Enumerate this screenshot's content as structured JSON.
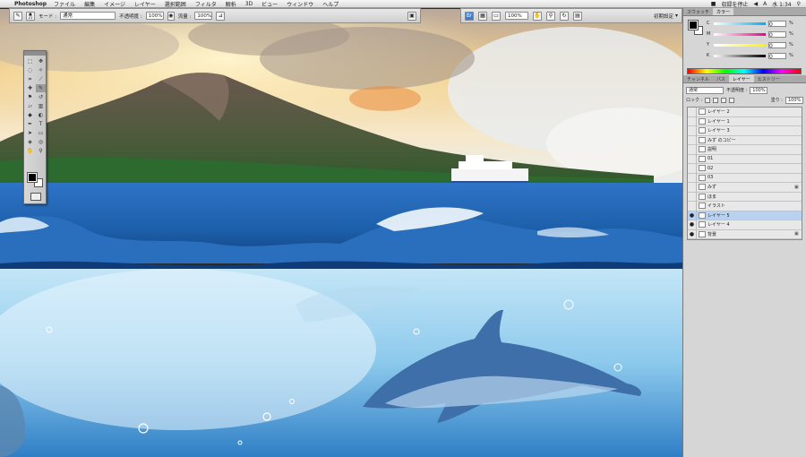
{
  "menubar": {
    "app_name": "Photoshop",
    "items": [
      "ファイル",
      "編集",
      "イメージ",
      "レイヤー",
      "選択範囲",
      "フィルタ",
      "解析",
      "3D",
      "ビュー",
      "ウィンドウ",
      "ヘルプ"
    ],
    "status_text": "収録を停止",
    "clock": "水 1:34"
  },
  "options_bar": {
    "brush_size": "21",
    "mode_label": "モード :",
    "mode_value": "通常",
    "opacity_label": "不透明度 :",
    "opacity_value": "100%",
    "flow_label": "流量 :",
    "flow_value": "100%"
  },
  "app_bar": {
    "zoom": "100%",
    "workspace": "初期設定"
  },
  "color_panel": {
    "tabs": [
      "スウォッチ",
      "カラー"
    ],
    "active_tab": "カラー",
    "channels": [
      {
        "label": "C",
        "value": "0",
        "unit": "%"
      },
      {
        "label": "M",
        "value": "0",
        "unit": "%"
      },
      {
        "label": "Y",
        "value": "0",
        "unit": "%"
      },
      {
        "label": "K",
        "value": "0",
        "unit": "%"
      }
    ]
  },
  "layers_panel": {
    "tabs": [
      "チャンネル",
      "パス",
      "レイヤー",
      "ヒストリー"
    ],
    "active_tab": "レイヤー",
    "blend_mode": "通常",
    "opacity_label": "不透明度 :",
    "opacity_value": "100%",
    "lock_label": "ロック :",
    "fill_label": "塗り :",
    "fill_value": "100%",
    "layers": [
      {
        "name": "レイヤー 2",
        "visible": false,
        "locked": false,
        "selected": false
      },
      {
        "name": "レイヤー 1",
        "visible": false,
        "locked": false,
        "selected": false
      },
      {
        "name": "レイヤー 3",
        "visible": false,
        "locked": false,
        "selected": false
      },
      {
        "name": "みず のコピー",
        "visible": false,
        "locked": false,
        "selected": false
      },
      {
        "name": "説明",
        "visible": false,
        "locked": false,
        "selected": false
      },
      {
        "name": "01",
        "visible": false,
        "locked": false,
        "selected": false
      },
      {
        "name": "02",
        "visible": false,
        "locked": false,
        "selected": false
      },
      {
        "name": "03",
        "visible": false,
        "locked": false,
        "selected": false
      },
      {
        "name": "みず",
        "visible": false,
        "locked": true,
        "selected": false
      },
      {
        "name": "ほま",
        "visible": false,
        "locked": false,
        "selected": false
      },
      {
        "name": "イラスト",
        "visible": false,
        "locked": false,
        "selected": false
      },
      {
        "name": "レイヤー 5",
        "visible": true,
        "locked": false,
        "selected": true
      },
      {
        "name": "レイヤー 4",
        "visible": true,
        "locked": false,
        "selected": false
      },
      {
        "name": "背景",
        "visible": true,
        "locked": true,
        "selected": false
      }
    ]
  },
  "colors": {
    "sky": "#f0d9a8",
    "sea_deep": "#1c5ea8",
    "underwater": "#9fd3ee",
    "selected_layer": "#b8d2f0"
  }
}
